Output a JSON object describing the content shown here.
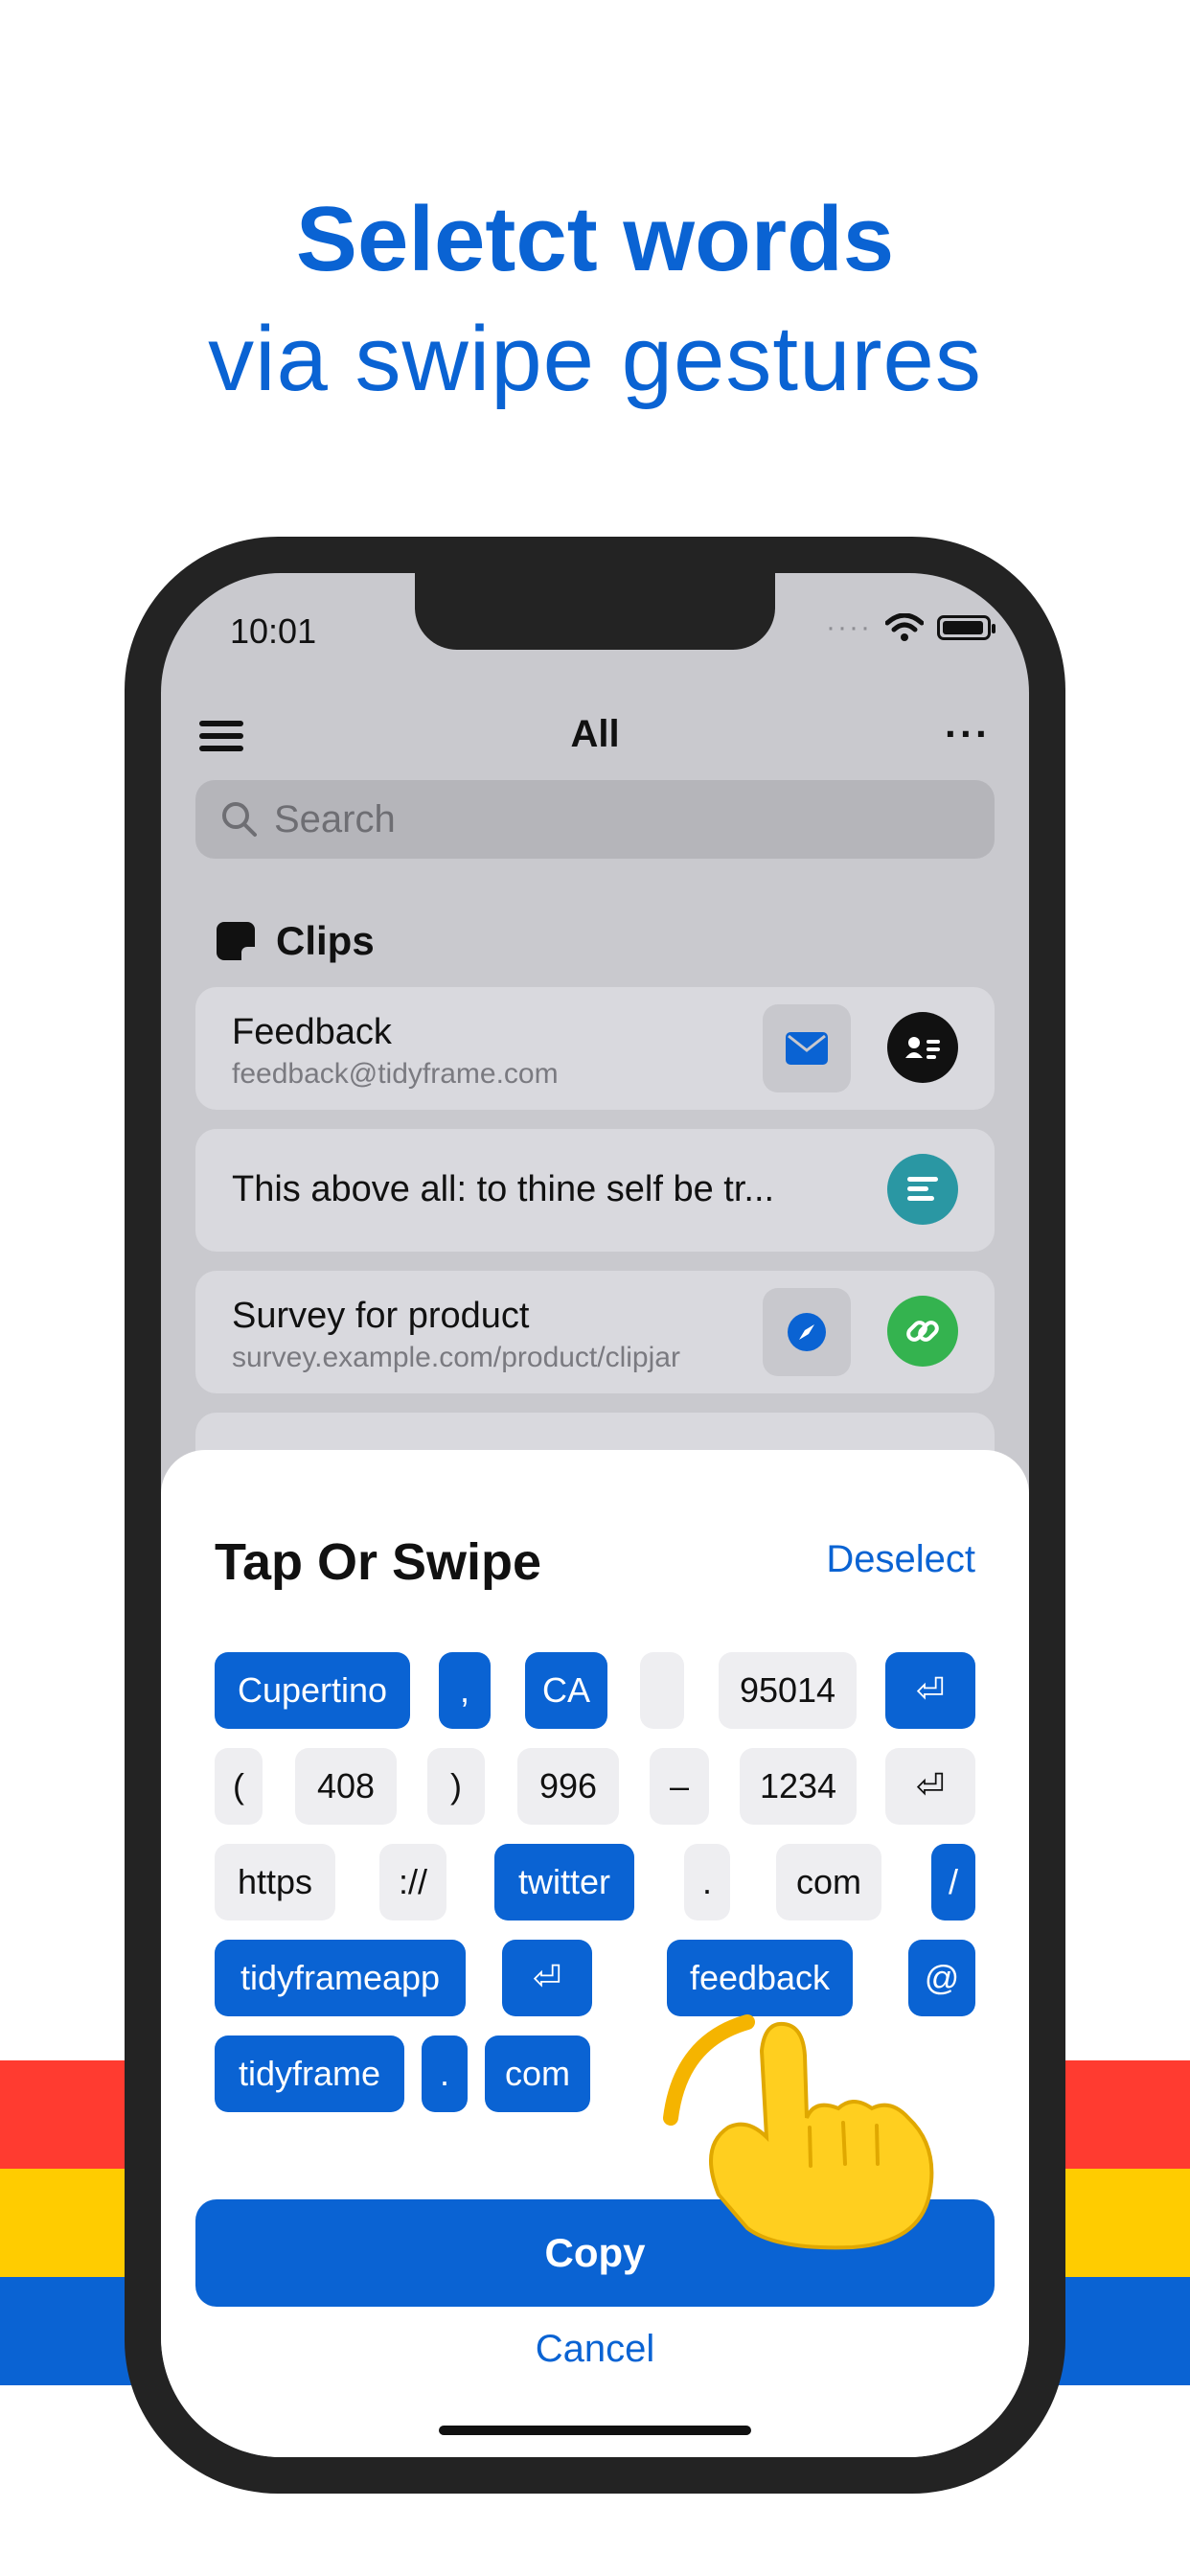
{
  "headline": {
    "line1": "Seletct words",
    "line2": "via swipe gestures"
  },
  "status": {
    "time": "10:01",
    "dots": "····"
  },
  "nav": {
    "title": "All",
    "more": "···"
  },
  "search": {
    "placeholder": "Search"
  },
  "section": {
    "title": "Clips"
  },
  "clips": [
    {
      "title": "Feedback",
      "subtitle": "feedback@tidyframe.com"
    },
    {
      "title": "This above all: to thine self be tr..."
    },
    {
      "title": "Survey for product",
      "subtitle": "survey.example.com/product/clipjar"
    }
  ],
  "sheet": {
    "title": "Tap Or Swipe",
    "deselect": "Deselect",
    "copy": "Copy",
    "cancel": "Cancel"
  },
  "tokens": [
    [
      "Cupertino",
      ",",
      "CA",
      "",
      "95014",
      "⏎"
    ],
    [
      "(",
      "408",
      ")",
      "996",
      "–",
      "1234",
      "⏎"
    ],
    [
      "https",
      "://",
      "twitter",
      ".",
      "com",
      "/"
    ],
    [
      "tidyframeapp",
      "⏎",
      "feedback",
      "@"
    ],
    [
      "tidyframe",
      ".",
      "com"
    ]
  ],
  "colors": {
    "accent": "#0a63d3",
    "red": "#ff3b30",
    "yellow": "#ffcc00",
    "blue": "#0a63d3"
  }
}
